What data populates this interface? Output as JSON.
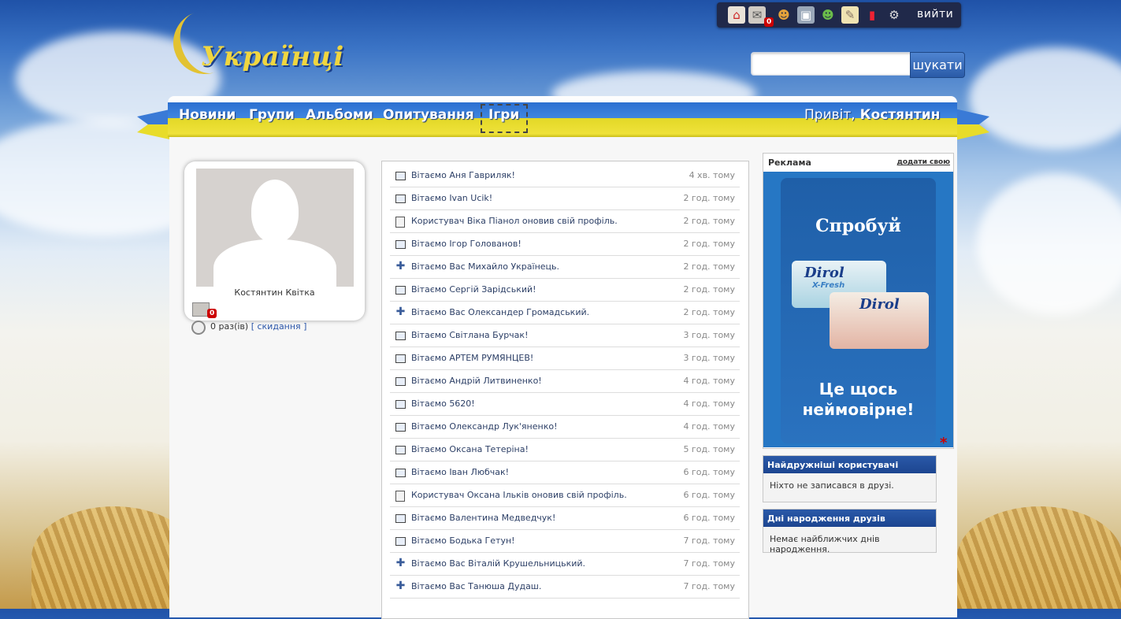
{
  "logo": {
    "text": "Українці"
  },
  "toolbar": {
    "icons": [
      "home-icon",
      "mail-icon",
      "users-icon",
      "photo-icon",
      "groups-icon",
      "notes-icon",
      "stats-icon",
      "gear-icon"
    ],
    "mail_count": "0",
    "logout_label": "вийти"
  },
  "search": {
    "value": "",
    "button_label": "шукати"
  },
  "nav": {
    "items": [
      {
        "label": "Новини"
      },
      {
        "label": "Групи"
      },
      {
        "label": "Альбоми"
      },
      {
        "label": "Опитування"
      },
      {
        "label": "Ігри"
      }
    ],
    "greeting": "Привіт,",
    "user_name": "Костянтин"
  },
  "profile": {
    "name": "Костянтин Квітка",
    "mail_count": "0",
    "visits_count": "0 раз(ів)",
    "reset_label": "[ скидання ]"
  },
  "feed": [
    {
      "icon": "pc",
      "text": "Вітаємо Аня Гавриляк!",
      "time": "4 хв. тому"
    },
    {
      "icon": "pc",
      "text": "Вітаємо Ivan Ucik!",
      "time": "2 год. тому"
    },
    {
      "icon": "doc",
      "text": "Користувач Віка Піанол оновив свій профіль.",
      "time": "2 год. тому"
    },
    {
      "icon": "pc",
      "text": "Вітаємо Ігор Голованов!",
      "time": "2 год. тому"
    },
    {
      "icon": "plus",
      "text": "Вітаємо Вас Михайло Українець.",
      "time": "2 год. тому"
    },
    {
      "icon": "pc",
      "text": "Вітаємо Сергій Зарідський!",
      "time": "2 год. тому"
    },
    {
      "icon": "plus",
      "text": "Вітаємо Вас Олександер Громадський.",
      "time": "2 год. тому"
    },
    {
      "icon": "pc",
      "text": "Вітаємо Світлана Бурчак!",
      "time": "3 год. тому"
    },
    {
      "icon": "pc",
      "text": "Вітаємо АРТЕМ РУМЯНЦЕВ!",
      "time": "3 год. тому"
    },
    {
      "icon": "pc",
      "text": "Вітаємо Андрій Литвиненко!",
      "time": "4 год. тому"
    },
    {
      "icon": "pc",
      "text": "Вітаємо 5620!",
      "time": "4 год. тому"
    },
    {
      "icon": "pc",
      "text": "Вітаємо Олександр Лук'яненко!",
      "time": "4 год. тому"
    },
    {
      "icon": "pc",
      "text": "Вітаємо Оксана Тетеріна!",
      "time": "5 год. тому"
    },
    {
      "icon": "pc",
      "text": "Вітаємо Іван Любчак!",
      "time": "6 год. тому"
    },
    {
      "icon": "doc",
      "text": "Користувач Оксана Ільків оновив свій профіль.",
      "time": "6 год. тому"
    },
    {
      "icon": "pc",
      "text": "Вітаємо Валентина Медведчук!",
      "time": "6 год. тому"
    },
    {
      "icon": "pc",
      "text": "Вітаємо Бодька Гетун!",
      "time": "7 год. тому"
    },
    {
      "icon": "plus",
      "text": "Вітаємо Вас Віталій Крушельницький.",
      "time": "7 год. тому"
    },
    {
      "icon": "plus",
      "text": "Вітаємо Вас Танюша Дудаш.",
      "time": "7 год. тому"
    }
  ],
  "ad": {
    "title": "Реклама",
    "add_label": "додати свою",
    "slogan_top": "Спробуй",
    "brand": "Dirol",
    "brand_sub": "X-Fresh",
    "slogan_bottom_1": "Це щось",
    "slogan_bottom_2": "неймовірне!",
    "star": "*"
  },
  "friendliest": {
    "title": "Найдружніші користувачі",
    "body": "Ніхто не записався в друзі."
  },
  "birthdays": {
    "title": "Дні народження друзів",
    "body": "Немає найближчих днів народження."
  },
  "colors": {
    "nav_blue": "#2b6fd0",
    "nav_yellow": "#e3d827",
    "header_blue": "#1c4590"
  }
}
